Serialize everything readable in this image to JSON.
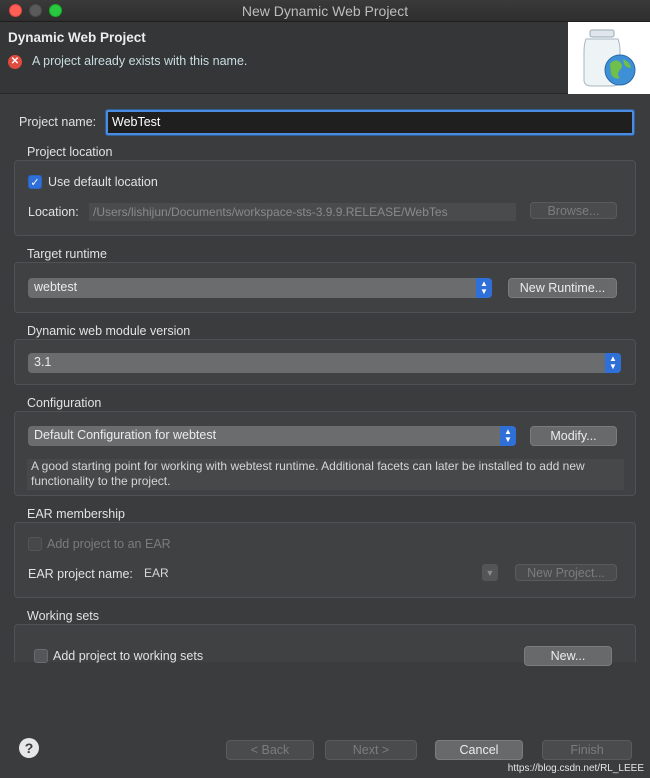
{
  "window": {
    "title": "New Dynamic Web Project"
  },
  "header": {
    "title": "Dynamic Web Project",
    "error_message": "A project already exists with this name."
  },
  "project_name": {
    "label": "Project name:",
    "value": "WebTest"
  },
  "project_location": {
    "title": "Project location",
    "use_default_label": "Use default location",
    "use_default_checked": true,
    "location_label": "Location:",
    "location_value": "/Users/lishijun/Documents/workspace-sts-3.9.9.RELEASE/WebTes",
    "browse_label": "Browse..."
  },
  "target_runtime": {
    "title": "Target runtime",
    "selected": "webtest",
    "new_runtime_label": "New Runtime..."
  },
  "module_version": {
    "title": "Dynamic web module version",
    "selected": "3.1"
  },
  "configuration": {
    "title": "Configuration",
    "selected": "Default Configuration for webtest",
    "modify_label": "Modify...",
    "description": "A good starting point for working with webtest runtime. Additional facets can later be installed to add new functionality to the project."
  },
  "ear": {
    "title": "EAR membership",
    "add_label": "Add project to an EAR",
    "name_label": "EAR project name:",
    "name_value": "EAR",
    "new_project_label": "New Project..."
  },
  "working_sets": {
    "title": "Working sets",
    "add_label": "Add project to working sets",
    "new_label": "New..."
  },
  "footer": {
    "back_label": "< Back",
    "next_label": "Next >",
    "cancel_label": "Cancel",
    "finish_label": "Finish",
    "watermark": "https://blog.csdn.net/RL_LEEE"
  },
  "colors": {
    "accent": "#2f6fd8",
    "error": "#e04b3f",
    "focus": "#4b8ce0"
  }
}
